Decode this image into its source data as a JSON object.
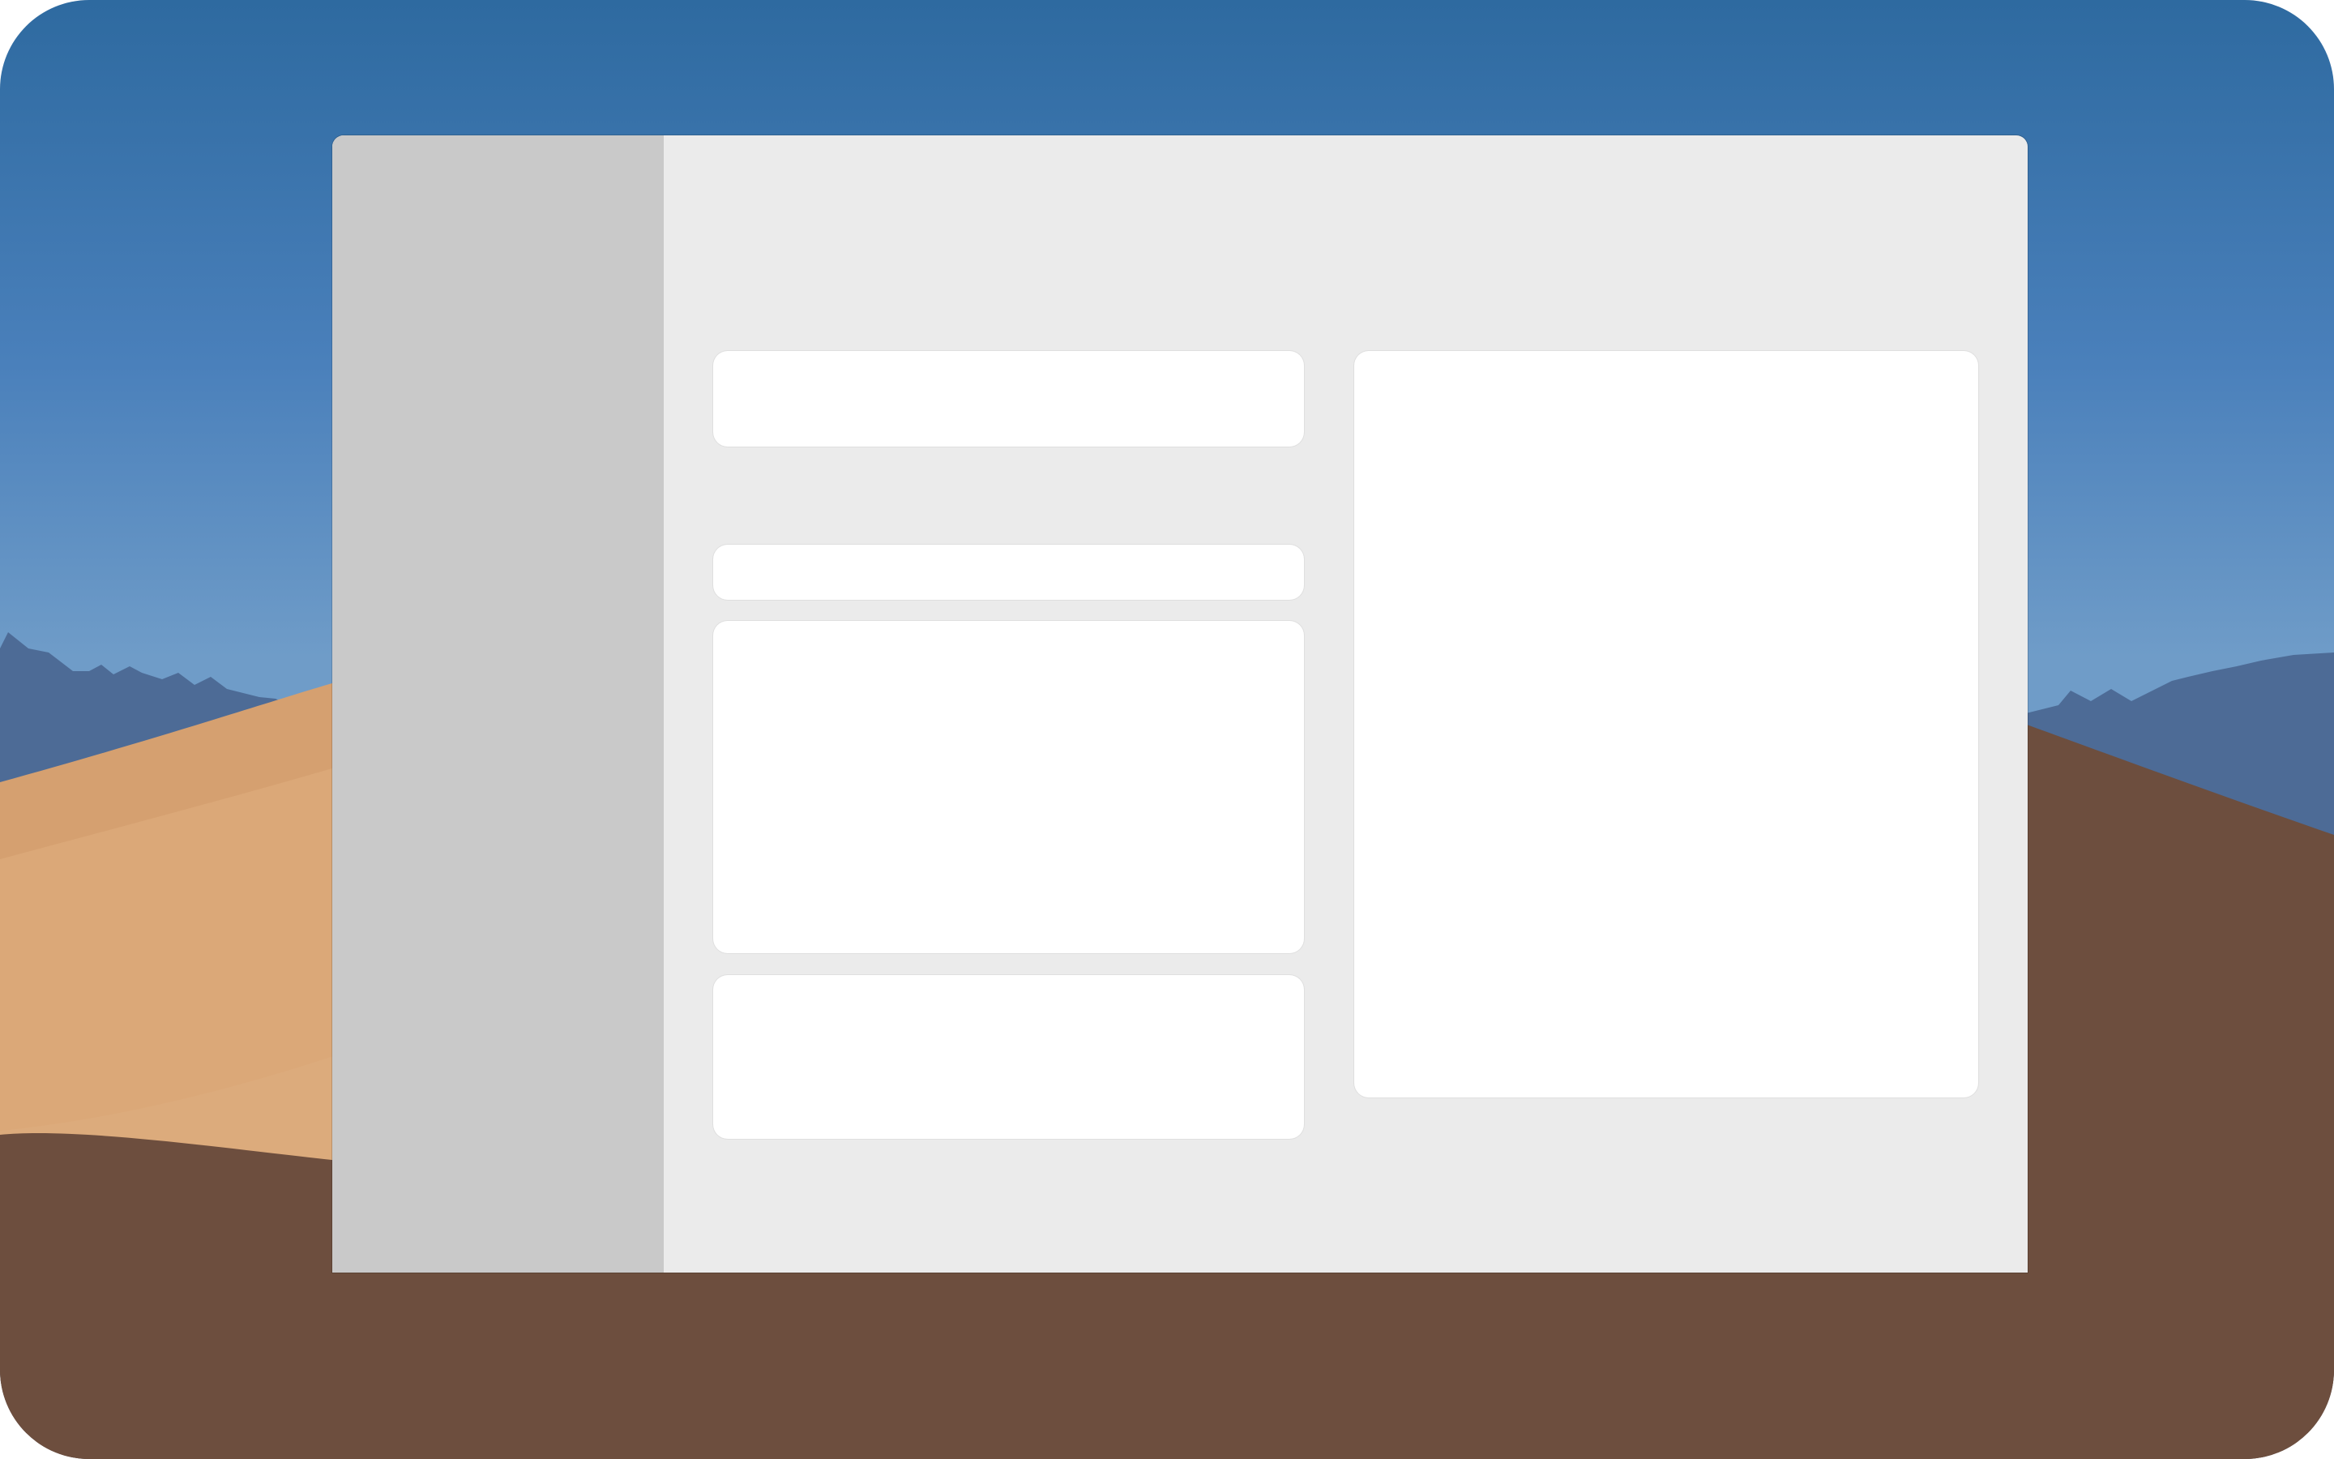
{
  "desktop": {
    "wallpaper_colors": {
      "sky_top": "#2e6aa0",
      "sky_bottom": "#6f9cc8",
      "mountains": "#4d6b96",
      "dunes": "#d6a06e",
      "ground": "#6d4e3e"
    }
  },
  "window": {
    "background": "#ebebeb",
    "sidebar_color": "#c9c9c9",
    "card_color": "#ffffff"
  }
}
